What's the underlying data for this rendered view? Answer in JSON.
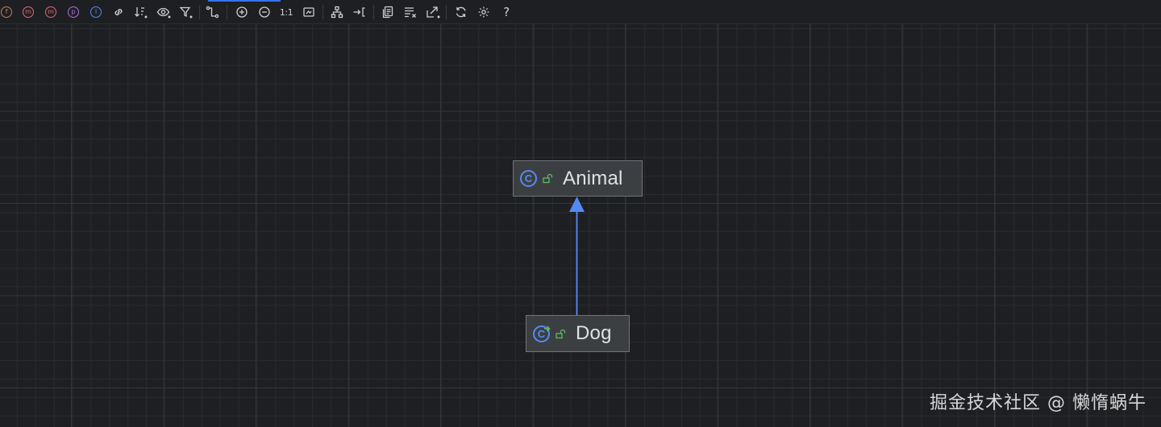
{
  "toolbar": {
    "items": [
      {
        "name": "fields-icon",
        "glyph": "f",
        "color": "#c77d55"
      },
      {
        "name": "constructors-icon",
        "glyph": "m",
        "color": "#e06c75"
      },
      {
        "name": "methods-icon",
        "glyph": "m",
        "color": "#e06c75"
      },
      {
        "name": "properties-icon",
        "glyph": "p",
        "color": "#a872d8"
      },
      {
        "name": "inner-classes-icon",
        "glyph": "I",
        "color": "#548af7"
      }
    ],
    "actual_size_label": "1:1",
    "help_label": "?"
  },
  "diagram": {
    "nodes": [
      {
        "id": "animal",
        "label": "Animal",
        "icon_letter": "C",
        "kind": "class"
      },
      {
        "id": "dog",
        "label": "Dog",
        "icon_letter": "C",
        "kind": "class-inherited"
      }
    ],
    "edges": [
      {
        "from": "dog",
        "to": "animal",
        "type": "extends",
        "color": "#548af7"
      }
    ]
  },
  "watermark": "掘金技术社区 @ 懒惰蜗牛"
}
